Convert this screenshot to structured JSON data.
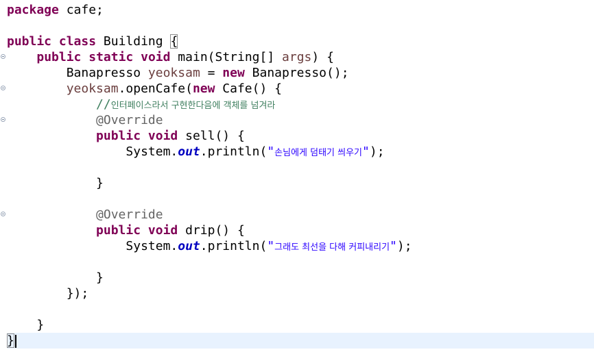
{
  "editor": {
    "package_kw": "package",
    "package_name": " cafe;",
    "public_kw": "public",
    "class_kw": "class",
    "class_name": " Building ",
    "open_brace": "{",
    "main_public": "public",
    "main_static": "static",
    "main_void": "void",
    "main_sig": " main(String[] ",
    "main_args": "args",
    "main_tail": ") {",
    "decl_type": "Banapresso ",
    "decl_var": "yeoksam",
    "decl_eq": " = ",
    "decl_new": "new",
    "decl_tail": " Banapresso();",
    "call_var": "yeoksam",
    "call_method": ".openCafe(",
    "call_new": "new",
    "call_tail": " Cafe() {",
    "comment_prefix": "//",
    "comment_text": "인터페이스라서 구현한다음에 객체를 넘겨라",
    "override1": "@Override",
    "sell_public": "public",
    "sell_void": "void",
    "sell_sig": " sell() {",
    "sysout1_prefix": "System.",
    "sysout1_field": "out",
    "sysout1_call": ".println(",
    "sysout1_q1": "\"",
    "sysout1_text": "손님에게 덤태기 씌우기",
    "sysout1_q2": "\"",
    "sysout1_end": ");",
    "sell_close": "}",
    "override2": "@Override",
    "drip_public": "public",
    "drip_void": "void",
    "drip_sig": " drip() {",
    "sysout2_prefix": "System.",
    "sysout2_field": "out",
    "sysout2_call": ".println(",
    "sysout2_q1": "\"",
    "sysout2_text": "그래도 최선을 다해 커피내리기",
    "sysout2_q2": "\"",
    "sysout2_end": ");",
    "drip_close": "}",
    "anon_close": "});",
    "main_close": "}",
    "class_close": "}"
  },
  "colors": {
    "keyword": "#7f0055",
    "annotation": "#646464",
    "comment": "#3f7f5f",
    "string": "#2a00ff",
    "static_field": "#0000c0",
    "local_var": "#6a3e3e",
    "current_line": "#e8f2fe"
  },
  "icons": {
    "fold_markers": "collapse-fold-icon"
  }
}
